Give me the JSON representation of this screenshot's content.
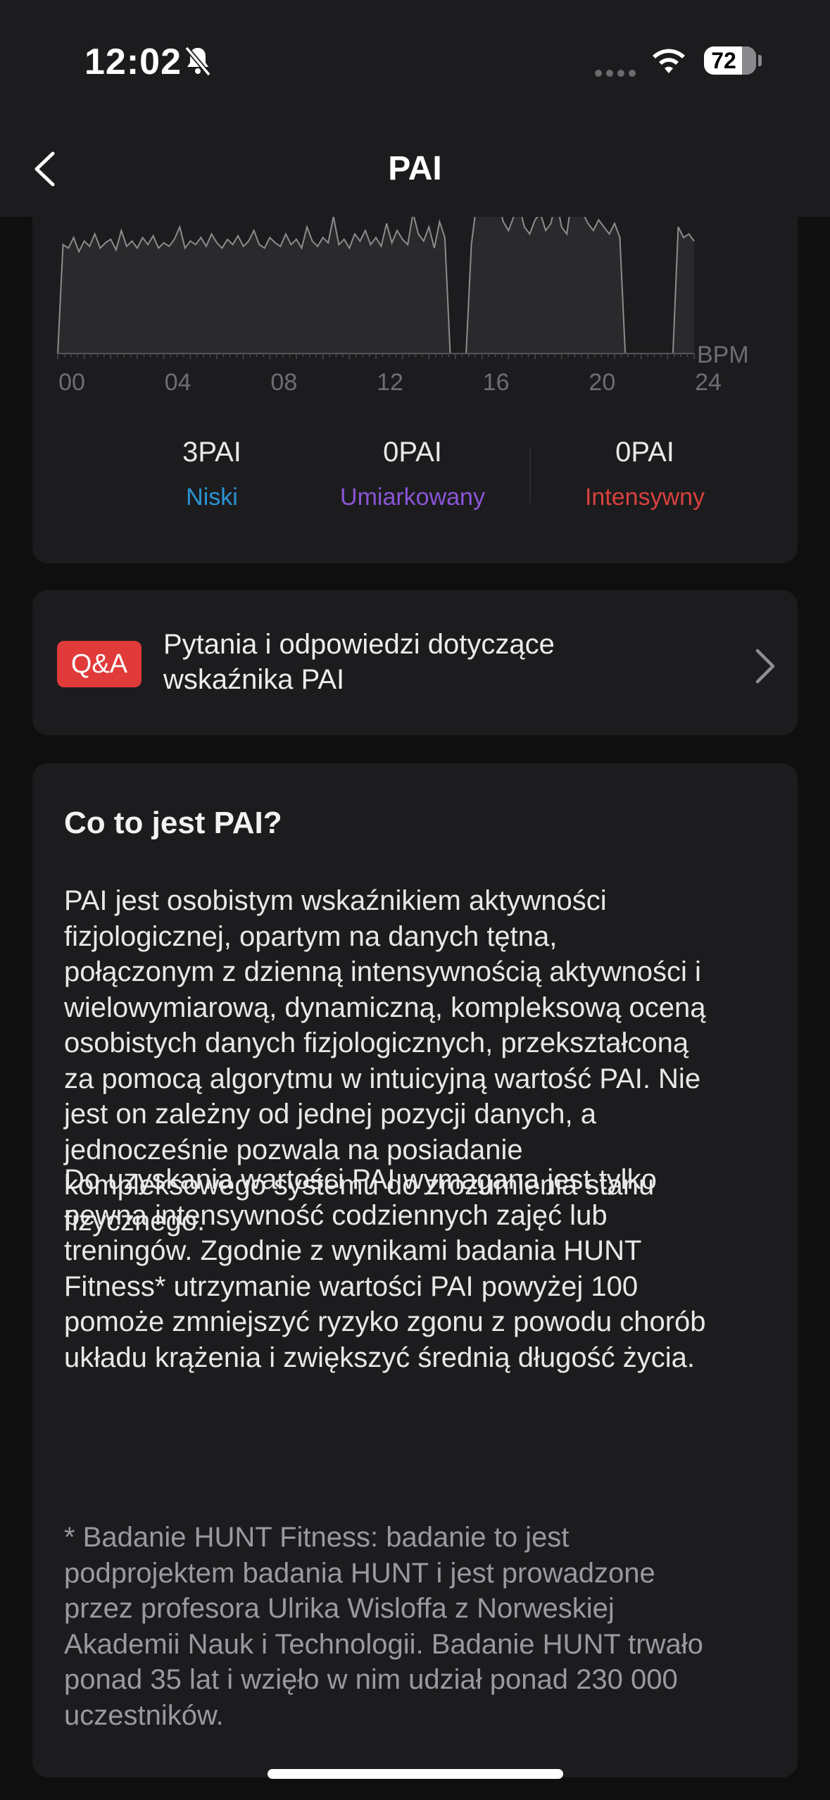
{
  "status_bar": {
    "time": "12:02",
    "battery": "72"
  },
  "header": {
    "title": "PAI"
  },
  "chart": {
    "x_ticks": [
      "00",
      "04",
      "08",
      "12",
      "16",
      "20",
      "24"
    ],
    "unit": "BPM",
    "color_line": "#8c8c8e",
    "color_fill": "#2a2a2c"
  },
  "chart_data": {
    "type": "area",
    "xlabel": "",
    "ylabel": "BPM",
    "xlim": [
      0,
      24
    ],
    "x": [
      0,
      0.2,
      0.4,
      0.6,
      0.8,
      1,
      1.2,
      1.4,
      1.6,
      1.8,
      2,
      2.2,
      2.4,
      2.6,
      2.8,
      3,
      3.2,
      3.4,
      3.6,
      3.8,
      4,
      4.2,
      4.4,
      4.6,
      4.8,
      5,
      5.2,
      5.4,
      5.6,
      5.8,
      6,
      6.2,
      6.4,
      6.6,
      6.8,
      7,
      7.2,
      7.4,
      7.6,
      7.8,
      8,
      8.2,
      8.4,
      8.6,
      8.8,
      9,
      9.2,
      9.4,
      9.6,
      9.8,
      10,
      10.2,
      10.4,
      10.6,
      10.8,
      11,
      11.2,
      11.4,
      11.6,
      11.8,
      12,
      12.2,
      12.4,
      12.6,
      12.8,
      13,
      13.2,
      13.4,
      13.6,
      13.8,
      14,
      14.2,
      14.4,
      14.6,
      14.8,
      15,
      15.2,
      15.4,
      15.6,
      15.8,
      16,
      16.2,
      16.4,
      16.6,
      16.8,
      17,
      17.2,
      17.4,
      17.6,
      17.8,
      18,
      18.2,
      18.4,
      18.6,
      18.8,
      19,
      19.2,
      19.4,
      19.6,
      19.8,
      20,
      20.2,
      20.4,
      20.6,
      20.8,
      21,
      21.2,
      21.4,
      21.6,
      21.8,
      22,
      22.2,
      22.4,
      22.6,
      22.8,
      23,
      23.2,
      23.4,
      23.6,
      23.8,
      24
    ],
    "values": [
      0,
      62,
      60,
      66,
      58,
      64,
      61,
      68,
      60,
      63,
      65,
      59,
      70,
      61,
      64,
      60,
      66,
      62,
      67,
      60,
      63,
      61,
      65,
      72,
      60,
      64,
      62,
      66,
      61,
      68,
      63,
      60,
      65,
      62,
      67,
      61,
      64,
      70,
      62,
      60,
      66,
      63,
      61,
      68,
      62,
      65,
      60,
      72,
      64,
      61,
      66,
      63,
      78,
      62,
      65,
      60,
      68,
      64,
      70,
      62,
      66,
      61,
      74,
      63,
      70,
      65,
      62,
      80,
      68,
      64,
      72,
      60,
      75,
      66,
      0,
      0,
      0,
      0,
      62,
      86,
      82,
      90,
      92,
      88,
      75,
      70,
      78,
      84,
      72,
      68,
      76,
      80,
      70,
      74,
      88,
      72,
      68,
      90,
      95,
      80,
      74,
      70,
      76,
      72,
      68,
      74,
      66,
      0,
      0,
      0,
      0,
      0,
      0,
      0,
      0,
      0,
      0,
      72,
      66,
      68,
      64
    ],
    "series_legend": [
      {
        "value": "3PAI",
        "label": "Niski"
      },
      {
        "value": "0PAI",
        "label": "Umiarkowany"
      },
      {
        "value": "0PAI",
        "label": "Intensywny"
      }
    ]
  },
  "pai_breakdown": [
    {
      "value": "3PAI",
      "label": "Niski",
      "color": "#2a94d4"
    },
    {
      "value": "0PAI",
      "label": "Umiarkowany",
      "color": "#8a55d6"
    },
    {
      "value": "0PAI",
      "label": "Intensywny",
      "color": "#d9413d"
    }
  ],
  "qa": {
    "badge": "Q&A",
    "line1": "Pytania i odpowiedzi dotyczące",
    "line2": "wskaźnika PAI"
  },
  "info": {
    "title": "Co to jest PAI?",
    "p1_lines": [
      "PAI jest osobistym wskaźnikiem aktywności",
      "fizjologicznej, opartym na danych tętna,",
      "połączonym z dzienną intensywnością aktywności i",
      "wielowymiarową, dynamiczną, kompleksową oceną",
      "osobistych danych fizjologicznych, przekształconą",
      "za pomocą algorytmu w intuicyjną wartość PAI. Nie",
      "jest on zależny od jednej pozycji danych, a",
      "jednocześnie pozwala na posiadanie",
      "kompleksowego systemu do zrozumienia stanu",
      "fizycznego."
    ],
    "p2_lines": [
      "Do uzyskania wartości PAI wymagana jest tylko",
      "pewna intensywność codziennych zajęć lub",
      "treningów. Zgodnie z wynikami badania HUNT",
      "Fitness* utrzymanie wartości PAI powyżej 100",
      "pomoże zmniejszyć ryzyko zgonu z powodu chorób",
      "układu krążenia i zwiększyć średnią długość życia."
    ],
    "note_lines": [
      "* Badanie HUNT Fitness: badanie to jest",
      "podprojektem badania HUNT i jest prowadzone",
      "przez profesora Ulrika Wisloffa z Norweskiej",
      "Akademii Nauk i Technologii. Badanie HUNT trwało",
      "ponad 35 lat i wzięło w nim udział ponad 230 000",
      "uczestników."
    ]
  }
}
